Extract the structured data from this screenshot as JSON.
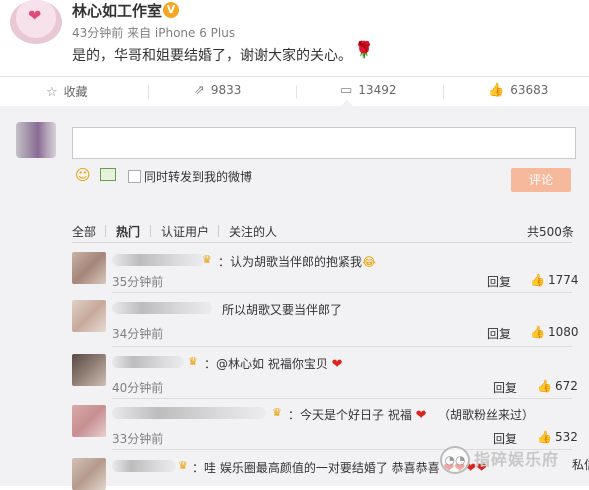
{
  "post": {
    "account_name": "林心如工作室",
    "verified_badge": "V",
    "meta": "43分钟前 来自 iPhone 6 Plus",
    "text": "是的，华哥和姐要结婚了，谢谢大家的关心。",
    "emoji_icon": "rose-icon",
    "logo_icon": "heart-logo-icon"
  },
  "actions": {
    "favorite": {
      "icon": "star-icon",
      "label": "收藏"
    },
    "repost": {
      "icon": "repost-icon",
      "label": "9833"
    },
    "comment": {
      "icon": "comment-icon",
      "label": "13492"
    },
    "like": {
      "icon": "thumbs-up-icon",
      "label": "63683"
    }
  },
  "composer": {
    "input_value": "",
    "also_repost_label": "同时转发到我的微博",
    "submit_label": "评论",
    "submit_color": "#f7b99c"
  },
  "filters": {
    "tabs": [
      "全部",
      "热门",
      "认证用户",
      "关注的人"
    ],
    "active": "热门",
    "total": "共500条"
  },
  "comments": [
    {
      "text": "：认为胡歌当伴郎的抱紧我",
      "emoji": "😂",
      "time": "35分钟前",
      "reply": "回复",
      "likes": "1774"
    },
    {
      "text": "所以胡歌又要当伴郎了",
      "emoji": "",
      "time": "34分钟前",
      "reply": "回复",
      "likes": "1080"
    },
    {
      "text": "：@林心如 祝福你宝贝",
      "emoji": "❤",
      "time": "40分钟前",
      "reply": "回复",
      "likes": "672"
    },
    {
      "text": "：今天是个好日子  祝福",
      "emoji": "❤",
      "extra": "（胡歌粉丝来过）",
      "time": "33分钟前",
      "reply": "回复",
      "likes": "532"
    },
    {
      "text": "：哇 娱乐圈最高颜值的一对要结婚了 恭喜恭喜",
      "emoji": "❤❤❤❤",
      "time": "",
      "reply": "",
      "likes": ""
    }
  ],
  "watermark": {
    "text": "指碎娱乐府",
    "icon": "wechat-icon"
  },
  "side_label": "私信",
  "colors": {
    "accent": "#f7b99c",
    "background": "#f2f2f5",
    "heart": "#d9251c",
    "badge": "#f5a623"
  }
}
